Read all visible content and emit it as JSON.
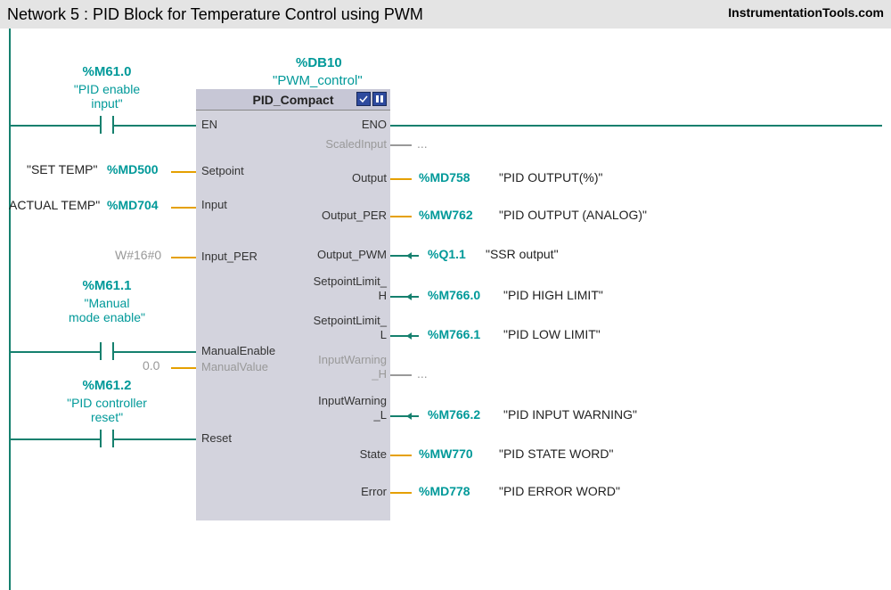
{
  "title": "Network 5 : PID Block for Temperature Control using PWM",
  "watermark": "InstrumentationTools.com",
  "db": {
    "addr": "%DB10",
    "name": "\"PWM_control\""
  },
  "block": {
    "title": "PID_Compact"
  },
  "contacts": {
    "en": {
      "addr": "%M61.0",
      "name": "\"PID enable",
      "name2": "input\""
    },
    "manual": {
      "addr": "%M61.1",
      "name": "\"Manual",
      "name2": "mode enable\""
    },
    "reset": {
      "addr": "%M61.2",
      "name": "\"PID controller",
      "name2": "reset\""
    }
  },
  "inputs": {
    "en": {
      "port": "EN"
    },
    "setpoint": {
      "port": "Setpoint",
      "addr": "%MD500",
      "comment": "\"SET TEMP\""
    },
    "input": {
      "port": "Input",
      "addr": "%MD704",
      "comment": "ACTUAL TEMP\""
    },
    "input_per": {
      "port": "Input_PER",
      "addr": "W#16#0"
    },
    "manualEn": {
      "port": "ManualEnable"
    },
    "manualVal": {
      "port": "ManualValue",
      "addr": "0.0"
    },
    "reset": {
      "port": "Reset"
    }
  },
  "outputs": {
    "eno": {
      "port": "ENO"
    },
    "scaled": {
      "port": "ScaledInput",
      "ellipsis": "..."
    },
    "output": {
      "port": "Output",
      "addr": "%MD758",
      "comment": "\"PID OUTPUT(%)\""
    },
    "output_per": {
      "port": "Output_PER",
      "addr": "%MW762",
      "comment": "\"PID OUTPUT (ANALOG)\""
    },
    "output_pwm": {
      "port": "Output_PWM",
      "addr": "%Q1.1",
      "comment": "\"SSR output\""
    },
    "sp_h": {
      "port": "SetpointLimit_",
      "port2": "H",
      "addr": "%M766.0",
      "comment": "\"PID HIGH LIMIT\""
    },
    "sp_l": {
      "port": "SetpointLimit_",
      "port2": "L",
      "addr": "%M766.1",
      "comment": "\"PID LOW LIMIT\""
    },
    "iw_h": {
      "port": "InputWarning",
      "port2": "_H",
      "ellipsis": "..."
    },
    "iw_l": {
      "port": "InputWarning",
      "port2": "_L",
      "addr": "%M766.2",
      "comment": "\"PID INPUT WARNING\""
    },
    "state": {
      "port": "State",
      "addr": "%MW770",
      "comment": "\"PID STATE WORD\""
    },
    "error": {
      "port": "Error",
      "addr": "%MD778",
      "comment": "\"PID ERROR WORD\""
    }
  }
}
